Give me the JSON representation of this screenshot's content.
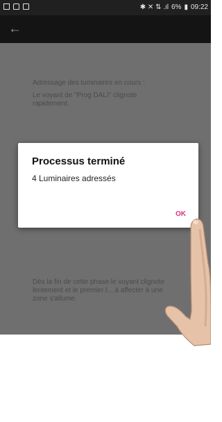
{
  "status_bar": {
    "indicators": "✱ ✕ ⇅ .ıl",
    "battery": "6%",
    "time": "09:22"
  },
  "icons": {
    "back": "back-arrow-icon"
  },
  "content": {
    "line1": "Adressage des luminaires en cours :",
    "line2": "Le voyant de \"Prog DALI\" clignote rapidement.",
    "line3": "Dès la fin de cette phase le voyant clignote lentement et le premier l... à affecter à une zone s'allume."
  },
  "dialog": {
    "title": "Processus terminé",
    "message": "4 Luminaires adressés",
    "ok_label": "OK"
  },
  "colors": {
    "accent": "#e0337a",
    "overlay": "#6f6f6f"
  }
}
